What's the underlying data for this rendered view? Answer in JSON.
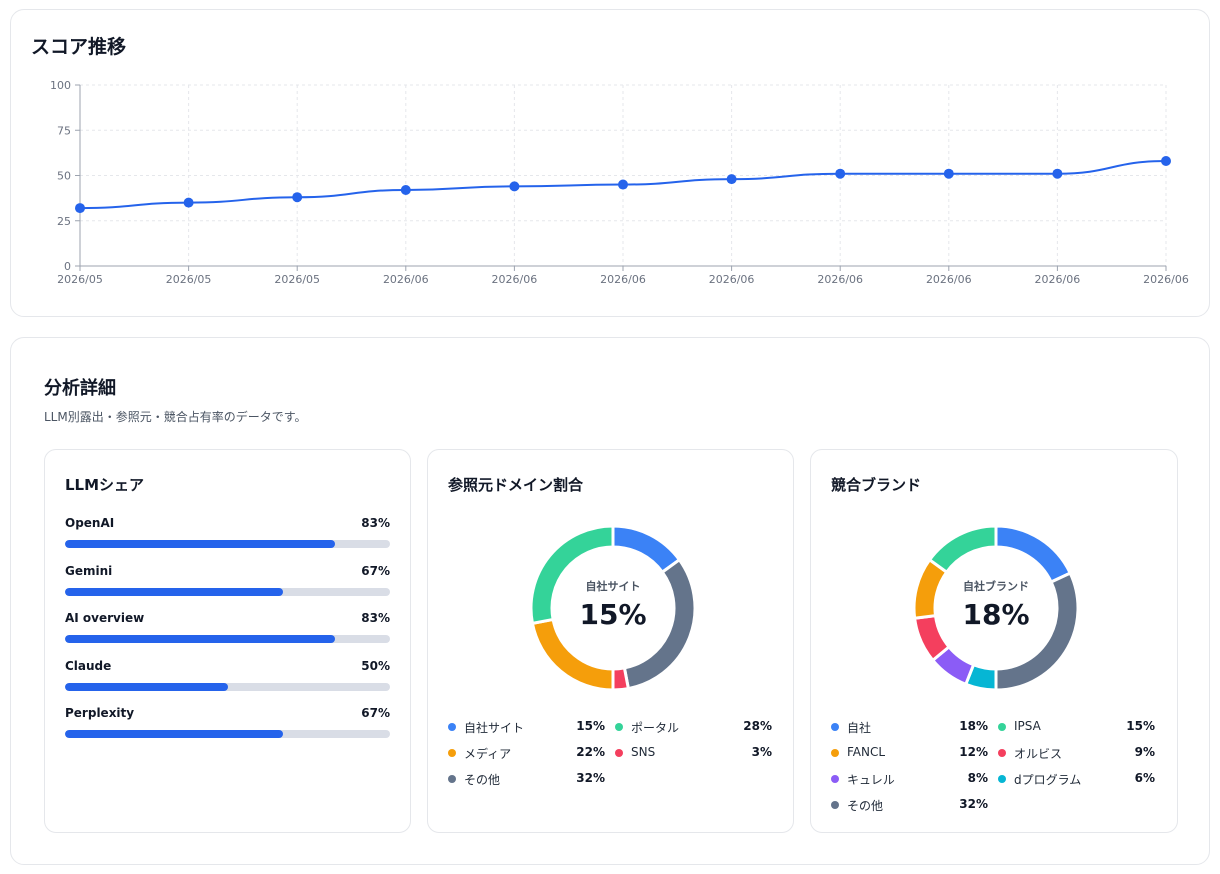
{
  "score_section": {
    "title": "スコア推移"
  },
  "chart_data": {
    "type": "line",
    "x": [
      "2026/05",
      "2026/05",
      "2026/05",
      "2026/06",
      "2026/06",
      "2026/06",
      "2026/06",
      "2026/06",
      "2026/06",
      "2026/06",
      "2026/06"
    ],
    "values": [
      32,
      35,
      38,
      42,
      44,
      45,
      48,
      51,
      51,
      51,
      58
    ],
    "ylim": [
      0,
      100
    ],
    "yticks": [
      0,
      25,
      50,
      75,
      100
    ],
    "grid": true,
    "color": "#2563eb"
  },
  "analysis": {
    "title": "分析詳細",
    "subtitle": "LLM別露出・参照元・競合占有率のデータです。"
  },
  "llm_share": {
    "title": "LLMシェア",
    "items": [
      {
        "name": "OpenAI",
        "pct_label": "83%",
        "value": 83
      },
      {
        "name": "Gemini",
        "pct_label": "67%",
        "value": 67
      },
      {
        "name": "AI overview",
        "pct_label": "83%",
        "value": 83
      },
      {
        "name": "Claude",
        "pct_label": "50%",
        "value": 50
      },
      {
        "name": "Perplexity",
        "pct_label": "67%",
        "value": 67
      }
    ]
  },
  "domain_share": {
    "title": "参照元ドメイン割合",
    "center_label": "自社サイト",
    "center_value": "15%",
    "slices": [
      {
        "name": "自社サイト",
        "pct_label": "15%",
        "value": 15,
        "color": "#3b82f6"
      },
      {
        "name": "その他",
        "pct_label": "32%",
        "value": 32,
        "color": "#64748b"
      },
      {
        "name": "SNS",
        "pct_label": "3%",
        "value": 3,
        "color": "#f43f5e"
      },
      {
        "name": "メディア",
        "pct_label": "22%",
        "value": 22,
        "color": "#f59e0b"
      },
      {
        "name": "ポータル",
        "pct_label": "28%",
        "value": 28,
        "color": "#34d399"
      }
    ],
    "legend_order": [
      "自社サイト",
      "ポータル",
      "メディア",
      "SNS",
      "その他"
    ]
  },
  "brand_share": {
    "title": "競合ブランド",
    "center_label": "自社ブランド",
    "center_value": "18%",
    "slices": [
      {
        "name": "自社",
        "pct_label": "18%",
        "value": 18,
        "color": "#3b82f6"
      },
      {
        "name": "その他",
        "pct_label": "32%",
        "value": 32,
        "color": "#64748b"
      },
      {
        "name": "dプログラム",
        "pct_label": "6%",
        "value": 6,
        "color": "#06b6d4"
      },
      {
        "name": "キュレル",
        "pct_label": "8%",
        "value": 8,
        "color": "#8b5cf6"
      },
      {
        "name": "オルビス",
        "pct_label": "9%",
        "value": 9,
        "color": "#f43f5e"
      },
      {
        "name": "FANCL",
        "pct_label": "12%",
        "value": 12,
        "color": "#f59e0b"
      },
      {
        "name": "IPSA",
        "pct_label": "15%",
        "value": 15,
        "color": "#34d399"
      }
    ],
    "legend_order": [
      "自社",
      "IPSA",
      "FANCL",
      "オルビス",
      "キュレル",
      "dプログラム",
      "その他"
    ]
  }
}
